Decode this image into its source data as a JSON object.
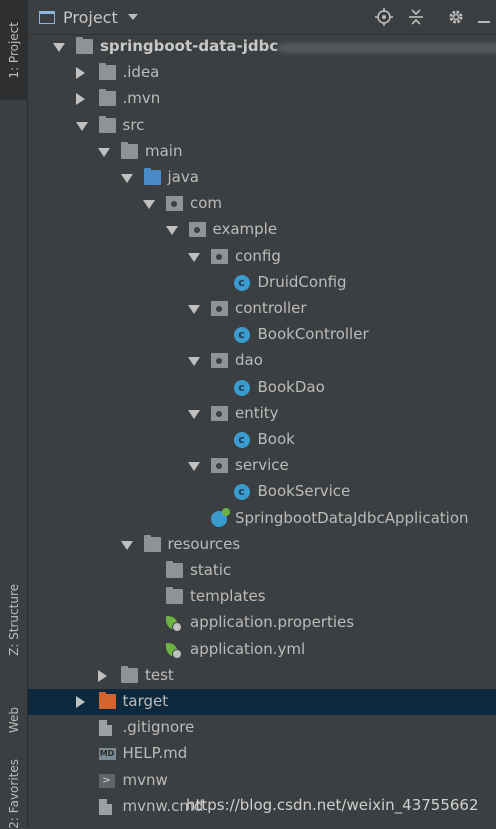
{
  "sidebar": {
    "project_tab": "1: Project",
    "structure_tab": "Z: Structure",
    "web_tab": "Web",
    "favorites_tab": "2: Favorites"
  },
  "header": {
    "title": "Project",
    "icons": [
      "target-icon",
      "collapse-all-icon",
      "gear-icon",
      "hide-icon"
    ]
  },
  "tree": [
    {
      "label": "springboot-data-jdbc",
      "depth": 0,
      "expanded": true,
      "icon": "module-folder",
      "bold": true
    },
    {
      "label": ".idea",
      "depth": 1,
      "expanded": false,
      "icon": "folder"
    },
    {
      "label": ".mvn",
      "depth": 1,
      "expanded": false,
      "icon": "folder"
    },
    {
      "label": "src",
      "depth": 1,
      "expanded": true,
      "icon": "folder"
    },
    {
      "label": "main",
      "depth": 2,
      "expanded": true,
      "icon": "folder"
    },
    {
      "label": "java",
      "depth": 3,
      "expanded": true,
      "icon": "source-folder"
    },
    {
      "label": "com",
      "depth": 4,
      "expanded": true,
      "icon": "package"
    },
    {
      "label": "example",
      "depth": 5,
      "expanded": true,
      "icon": "package"
    },
    {
      "label": "config",
      "depth": 6,
      "expanded": true,
      "icon": "package"
    },
    {
      "label": "DruidConfig",
      "depth": 7,
      "icon": "class"
    },
    {
      "label": "controller",
      "depth": 6,
      "expanded": true,
      "icon": "package"
    },
    {
      "label": "BookController",
      "depth": 7,
      "icon": "class"
    },
    {
      "label": "dao",
      "depth": 6,
      "expanded": true,
      "icon": "package"
    },
    {
      "label": "BookDao",
      "depth": 7,
      "icon": "class"
    },
    {
      "label": "entity",
      "depth": 6,
      "expanded": true,
      "icon": "package"
    },
    {
      "label": "Book",
      "depth": 7,
      "icon": "class"
    },
    {
      "label": "service",
      "depth": 6,
      "expanded": true,
      "icon": "package"
    },
    {
      "label": "BookService",
      "depth": 7,
      "icon": "class"
    },
    {
      "label": "SpringbootDataJdbcApplication",
      "depth": 6,
      "icon": "spring-class"
    },
    {
      "label": "resources",
      "depth": 3,
      "expanded": true,
      "icon": "resources-folder"
    },
    {
      "label": "static",
      "depth": 4,
      "icon": "folder"
    },
    {
      "label": "templates",
      "depth": 4,
      "icon": "folder"
    },
    {
      "label": "application.properties",
      "depth": 4,
      "icon": "spring-config"
    },
    {
      "label": "application.yml",
      "depth": 4,
      "icon": "spring-config"
    },
    {
      "label": "test",
      "depth": 2,
      "expanded": false,
      "icon": "folder"
    },
    {
      "label": "target",
      "depth": 1,
      "expanded": false,
      "icon": "excluded-folder",
      "selected": true
    },
    {
      "label": ".gitignore",
      "depth": 1,
      "icon": "text-file"
    },
    {
      "label": "HELP.md",
      "depth": 1,
      "icon": "markdown-file"
    },
    {
      "label": "mvnw",
      "depth": 1,
      "icon": "shell-file"
    },
    {
      "label": "mvnw.cmd",
      "depth": 1,
      "icon": "text-file"
    }
  ],
  "watermark": "https://blog.csdn.net/weixin_43755662",
  "colors": {
    "background": "#3c3f41",
    "text": "#bbbbbb",
    "selection": "#0d293e",
    "class_icon": "#3a9bcf",
    "spring_green": "#6db33f",
    "source_folder": "#4a8ac9",
    "excluded_folder": "#d4652f"
  }
}
